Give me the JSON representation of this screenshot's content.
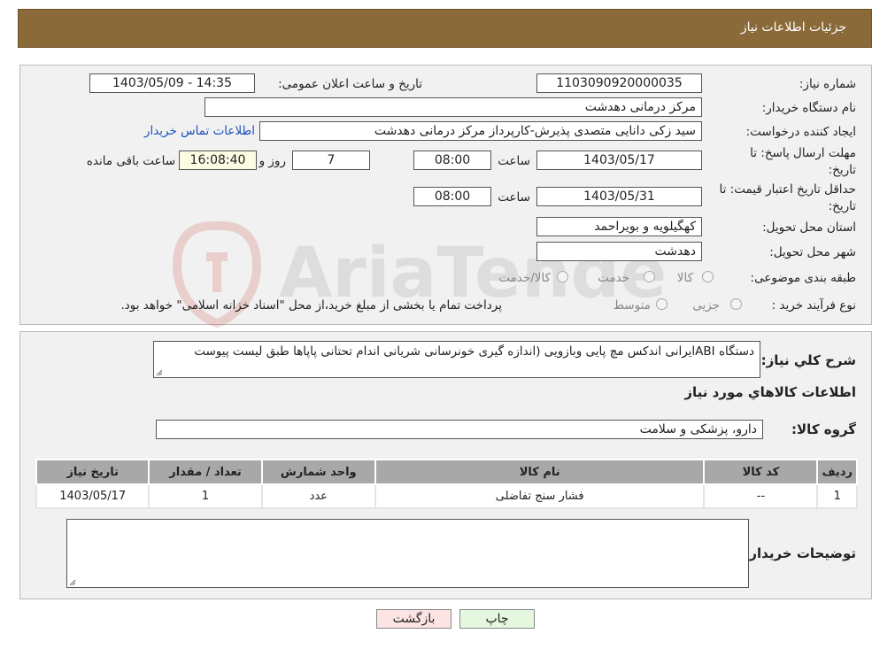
{
  "header": {
    "title": "جزئیات اطلاعات نیاز"
  },
  "fields": {
    "need_number_label": "شماره نیاز:",
    "need_number": "1103090920000035",
    "announce_label": "تاریخ و ساعت اعلان عمومی:",
    "announce_value": "1403/05/09 - 14:35",
    "buyer_org_label": "نام دستگاه خریدار:",
    "buyer_org": "مرکز درمانی دهدشت",
    "creator_label": "ایجاد کننده درخواست:",
    "creator": "سید زکی دانایی متصدی پذیرش-کارپرداز مرکز درمانی دهدشت",
    "contact_link": "اطلاعات تماس خریدار",
    "deadline_label_1": "مهلت ارسال پاسخ: تا",
    "deadline_label_2": "تاریخ:",
    "deadline_date": "1403/05/17",
    "time_label": "ساعت",
    "deadline_time": "08:00",
    "days_value": "7",
    "days_label": "روز و",
    "remaining_time": "16:08:40",
    "remaining_label": "ساعت باقی مانده",
    "validity_label_1": "حداقل تاریخ اعتبار قیمت: تا",
    "validity_label_2": "تاریخ:",
    "validity_date": "1403/05/31",
    "validity_time": "08:00",
    "province_label": "استان محل تحویل:",
    "province": "کهگیلویه و بویراحمد",
    "city_label": "شهر محل تحویل:",
    "city": "دهدشت",
    "category_label": "طبقه بندی موضوعی:",
    "category_options": [
      "کالا",
      "خدمت",
      "کالا/خدمت"
    ],
    "process_label": "نوع فرآیند خرید :",
    "process_options": [
      "جزیی",
      "متوسط"
    ],
    "process_note": "پرداخت تمام یا بخشی از مبلغ خرید،از محل \"اسناد خزانه اسلامی\" خواهد بود."
  },
  "details": {
    "summary_label": "شرح کلي نياز:",
    "summary_text": "دستگاه ABIایرانی اندکس مچ پایی وبازویی (اندازه گیری خونرسانی شریانی اندام تحتانی پاپاها طبق لیست پیوست",
    "goods_info_title": "اطلاعات کالاهاي مورد نياز",
    "goods_group_label": "گروه کالا:",
    "goods_group": "دارو، پزشکی و سلامت",
    "table_headers": [
      "رديف",
      "کد کالا",
      "نام کالا",
      "واحد شمارش",
      "تعداد / مقدار",
      "تاریخ نیاز"
    ],
    "rows": [
      {
        "index": "1",
        "code": "--",
        "name": "فشار سنج تفاضلی",
        "unit": "عدد",
        "qty": "1",
        "date": "1403/05/17"
      }
    ],
    "buyer_notes_label": "توضیحات خریدار:"
  },
  "buttons": {
    "print": "چاپ",
    "back": "بازگشت"
  },
  "watermark_text": "AriaTender.neT",
  "colors": {
    "header_bg": "#8a6a38",
    "link": "#1a4fbf",
    "table_header": "#a8a8a8",
    "back_button": "#fde4e4",
    "print_button": "#e6f7e0"
  }
}
